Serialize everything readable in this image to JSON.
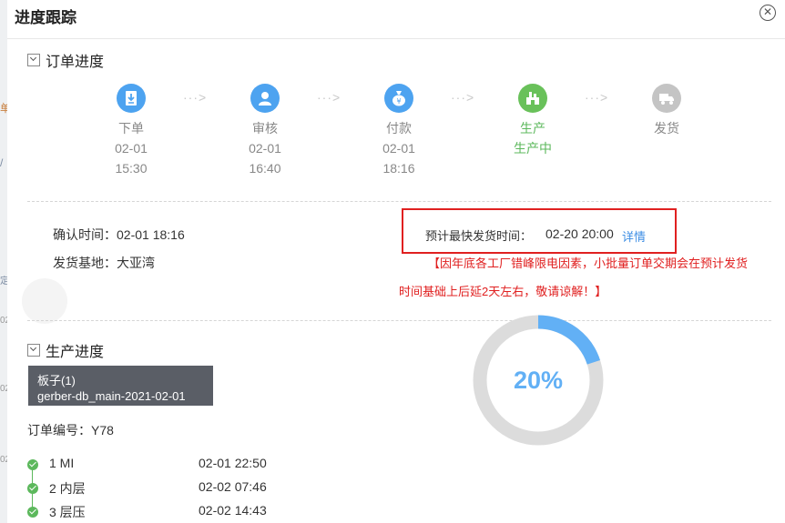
{
  "background": {
    "fragments": [
      "单",
      "/",
      "定",
      "02",
      "02",
      "02"
    ]
  },
  "header": {
    "title": "进度跟踪",
    "close_icon": "close-circle-icon"
  },
  "order_progress": {
    "section_title": "订单进度",
    "steps": [
      {
        "label": "下单",
        "date": "02-01",
        "time": "15:30",
        "icon": "order-download-icon",
        "color": "#4da3f0",
        "state": "done"
      },
      {
        "label": "审核",
        "date": "02-01",
        "time": "16:40",
        "icon": "reviewer-user-icon",
        "color": "#4da3f0",
        "state": "done"
      },
      {
        "label": "付款",
        "date": "02-01",
        "time": "18:16",
        "icon": "money-bag-icon",
        "color": "#4da3f0",
        "state": "done"
      },
      {
        "label": "生产",
        "date": "生产中",
        "time": "",
        "icon": "factory-production-icon",
        "color": "#69c15a",
        "state": "active"
      },
      {
        "label": "发货",
        "date": "",
        "time": "",
        "icon": "delivery-truck-icon",
        "color": "#c4c4c4",
        "state": "pending"
      }
    ],
    "arrow_text": "···>"
  },
  "confirm": {
    "label": "确认时间：",
    "value": "02-01 18:16"
  },
  "base": {
    "label": "发货基地：",
    "value": "大亚湾"
  },
  "shipping": {
    "label": "预计最快发货时间：",
    "value": "02-20 20:00",
    "link": "详情"
  },
  "notice": {
    "line1": "【因年底各工厂错峰限电因素，小批量订单交期会在预计发货",
    "line2": "时间基础上后延2天左右，敬请谅解！】"
  },
  "production": {
    "section_title": "生产进度",
    "product": {
      "line1": "板子(1)",
      "line2": "gerber-db_main-2021-02-01"
    },
    "order_number": "订单编号：Y78",
    "percent_text": "20%",
    "percent_value": 20,
    "colors": {
      "track": "#dcdcdc",
      "fill": "#62b0f5"
    },
    "processes": [
      {
        "name": "1 MI",
        "time": "02-01 22:50"
      },
      {
        "name": "2 内层",
        "time": "02-02 07:46"
      },
      {
        "name": "3 层压",
        "time": "02-02 14:43"
      }
    ]
  },
  "colors": {
    "accent_blue": "#4da3f0",
    "success_green": "#5cb85c",
    "alert_red": "#e02020",
    "link_blue": "#3d8ee4"
  }
}
